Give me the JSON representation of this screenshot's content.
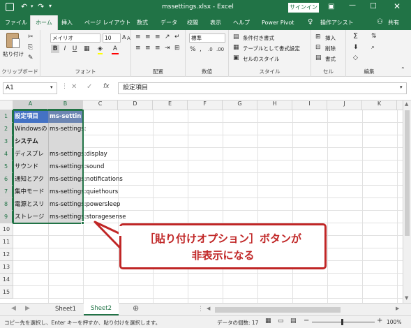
{
  "window": {
    "title": "mssettings.xlsx  -  Excel",
    "signin": "サインイン"
  },
  "ribbon_tabs": [
    "ファイル",
    "ホーム",
    "挿入",
    "ページ レイアウト",
    "数式",
    "データ",
    "校閲",
    "表示",
    "ヘルプ",
    "Power Pivot",
    "操作アシスト",
    "共有"
  ],
  "ribbon": {
    "clipboard": {
      "paste": "貼り付け",
      "label": "クリップボード"
    },
    "font": {
      "name": "メイリオ",
      "size": "10",
      "bold": "B",
      "italic": "I",
      "underline": "U",
      "grow": "A",
      "shrink": "A",
      "fontcolor": "A",
      "label": "フォント"
    },
    "alignment": {
      "label": "配置"
    },
    "number": {
      "format": "標準",
      "label": "数値"
    },
    "styles": {
      "conditional": "条件付き書式",
      "table": "テーブルとして書式設定",
      "cell": "セルのスタイル",
      "label": "スタイル"
    },
    "cells": {
      "insert": "挿入",
      "delete": "削除",
      "format": "書式",
      "label": "セル"
    },
    "editing": {
      "sigma": "Σ",
      "label": "編集"
    }
  },
  "formula_bar": {
    "namebox": "A1",
    "fx": "fx",
    "content": "設定項目"
  },
  "columns": [
    "A",
    "B",
    "C",
    "D",
    "E",
    "F",
    "G",
    "H",
    "I",
    "J",
    "K"
  ],
  "rows": [
    "1",
    "2",
    "3",
    "4",
    "5",
    "6",
    "7",
    "8",
    "9",
    "10",
    "11",
    "12",
    "13",
    "14",
    "15"
  ],
  "cells": {
    "a1": "設定項目",
    "b1": "ms-settin",
    "a2": "Windowsの",
    "b2": "ms-settings:",
    "a3": "システム",
    "a4": "ディスプレ",
    "b4": "ms-settings:display",
    "a5": "サウンド",
    "b5": "ms-settings:sound",
    "a6": "通知とアク",
    "b6": "ms-settings:notifications",
    "a7": "集中モード",
    "b7": "ms-settings:quiethours",
    "a8": "電源とスリ",
    "b8": "ms-settings:powersleep",
    "a9": "ストレージ",
    "b9": "ms-settings:storagesense"
  },
  "sheets": [
    "Sheet1",
    "Sheet2"
  ],
  "status": {
    "message": "コピー先を選択し、Enter キーを押すか、貼り付けを選択します。",
    "count": "データの個数: 17",
    "zoom": "100%"
  },
  "callout": {
    "line1": "［貼り付けオプション］ボタンが",
    "line2": "非表示になる"
  },
  "colors": {
    "excel_green": "#217346",
    "callout_red": "#c02626",
    "header_fill": "#4472c4"
  }
}
